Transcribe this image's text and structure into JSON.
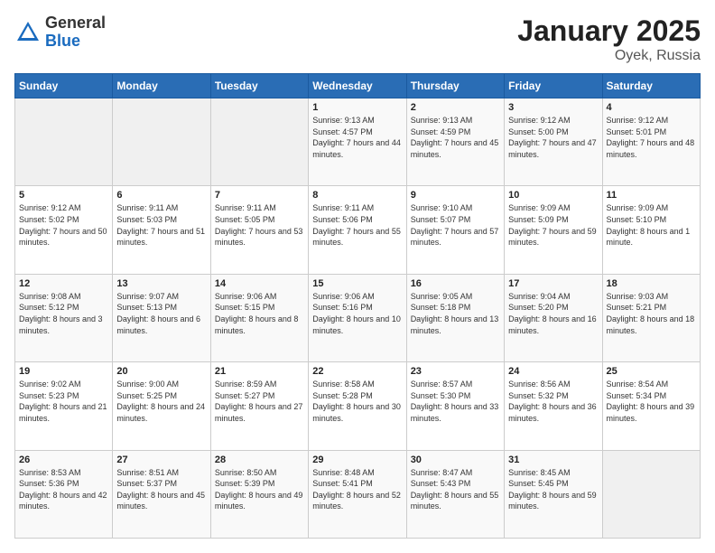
{
  "logo": {
    "general": "General",
    "blue": "Blue"
  },
  "title": "January 2025",
  "subtitle": "Oyek, Russia",
  "days_of_week": [
    "Sunday",
    "Monday",
    "Tuesday",
    "Wednesday",
    "Thursday",
    "Friday",
    "Saturday"
  ],
  "weeks": [
    [
      {
        "day": "",
        "info": ""
      },
      {
        "day": "",
        "info": ""
      },
      {
        "day": "",
        "info": ""
      },
      {
        "day": "1",
        "info": "Sunrise: 9:13 AM\nSunset: 4:57 PM\nDaylight: 7 hours\nand 44 minutes."
      },
      {
        "day": "2",
        "info": "Sunrise: 9:13 AM\nSunset: 4:59 PM\nDaylight: 7 hours\nand 45 minutes."
      },
      {
        "day": "3",
        "info": "Sunrise: 9:12 AM\nSunset: 5:00 PM\nDaylight: 7 hours\nand 47 minutes."
      },
      {
        "day": "4",
        "info": "Sunrise: 9:12 AM\nSunset: 5:01 PM\nDaylight: 7 hours\nand 48 minutes."
      }
    ],
    [
      {
        "day": "5",
        "info": "Sunrise: 9:12 AM\nSunset: 5:02 PM\nDaylight: 7 hours\nand 50 minutes."
      },
      {
        "day": "6",
        "info": "Sunrise: 9:11 AM\nSunset: 5:03 PM\nDaylight: 7 hours\nand 51 minutes."
      },
      {
        "day": "7",
        "info": "Sunrise: 9:11 AM\nSunset: 5:05 PM\nDaylight: 7 hours\nand 53 minutes."
      },
      {
        "day": "8",
        "info": "Sunrise: 9:11 AM\nSunset: 5:06 PM\nDaylight: 7 hours\nand 55 minutes."
      },
      {
        "day": "9",
        "info": "Sunrise: 9:10 AM\nSunset: 5:07 PM\nDaylight: 7 hours\nand 57 minutes."
      },
      {
        "day": "10",
        "info": "Sunrise: 9:09 AM\nSunset: 5:09 PM\nDaylight: 7 hours\nand 59 minutes."
      },
      {
        "day": "11",
        "info": "Sunrise: 9:09 AM\nSunset: 5:10 PM\nDaylight: 8 hours\nand 1 minute."
      }
    ],
    [
      {
        "day": "12",
        "info": "Sunrise: 9:08 AM\nSunset: 5:12 PM\nDaylight: 8 hours\nand 3 minutes."
      },
      {
        "day": "13",
        "info": "Sunrise: 9:07 AM\nSunset: 5:13 PM\nDaylight: 8 hours\nand 6 minutes."
      },
      {
        "day": "14",
        "info": "Sunrise: 9:06 AM\nSunset: 5:15 PM\nDaylight: 8 hours\nand 8 minutes."
      },
      {
        "day": "15",
        "info": "Sunrise: 9:06 AM\nSunset: 5:16 PM\nDaylight: 8 hours\nand 10 minutes."
      },
      {
        "day": "16",
        "info": "Sunrise: 9:05 AM\nSunset: 5:18 PM\nDaylight: 8 hours\nand 13 minutes."
      },
      {
        "day": "17",
        "info": "Sunrise: 9:04 AM\nSunset: 5:20 PM\nDaylight: 8 hours\nand 16 minutes."
      },
      {
        "day": "18",
        "info": "Sunrise: 9:03 AM\nSunset: 5:21 PM\nDaylight: 8 hours\nand 18 minutes."
      }
    ],
    [
      {
        "day": "19",
        "info": "Sunrise: 9:02 AM\nSunset: 5:23 PM\nDaylight: 8 hours\nand 21 minutes."
      },
      {
        "day": "20",
        "info": "Sunrise: 9:00 AM\nSunset: 5:25 PM\nDaylight: 8 hours\nand 24 minutes."
      },
      {
        "day": "21",
        "info": "Sunrise: 8:59 AM\nSunset: 5:27 PM\nDaylight: 8 hours\nand 27 minutes."
      },
      {
        "day": "22",
        "info": "Sunrise: 8:58 AM\nSunset: 5:28 PM\nDaylight: 8 hours\nand 30 minutes."
      },
      {
        "day": "23",
        "info": "Sunrise: 8:57 AM\nSunset: 5:30 PM\nDaylight: 8 hours\nand 33 minutes."
      },
      {
        "day": "24",
        "info": "Sunrise: 8:56 AM\nSunset: 5:32 PM\nDaylight: 8 hours\nand 36 minutes."
      },
      {
        "day": "25",
        "info": "Sunrise: 8:54 AM\nSunset: 5:34 PM\nDaylight: 8 hours\nand 39 minutes."
      }
    ],
    [
      {
        "day": "26",
        "info": "Sunrise: 8:53 AM\nSunset: 5:36 PM\nDaylight: 8 hours\nand 42 minutes."
      },
      {
        "day": "27",
        "info": "Sunrise: 8:51 AM\nSunset: 5:37 PM\nDaylight: 8 hours\nand 45 minutes."
      },
      {
        "day": "28",
        "info": "Sunrise: 8:50 AM\nSunset: 5:39 PM\nDaylight: 8 hours\nand 49 minutes."
      },
      {
        "day": "29",
        "info": "Sunrise: 8:48 AM\nSunset: 5:41 PM\nDaylight: 8 hours\nand 52 minutes."
      },
      {
        "day": "30",
        "info": "Sunrise: 8:47 AM\nSunset: 5:43 PM\nDaylight: 8 hours\nand 55 minutes."
      },
      {
        "day": "31",
        "info": "Sunrise: 8:45 AM\nSunset: 5:45 PM\nDaylight: 8 hours\nand 59 minutes."
      },
      {
        "day": "",
        "info": ""
      }
    ]
  ]
}
